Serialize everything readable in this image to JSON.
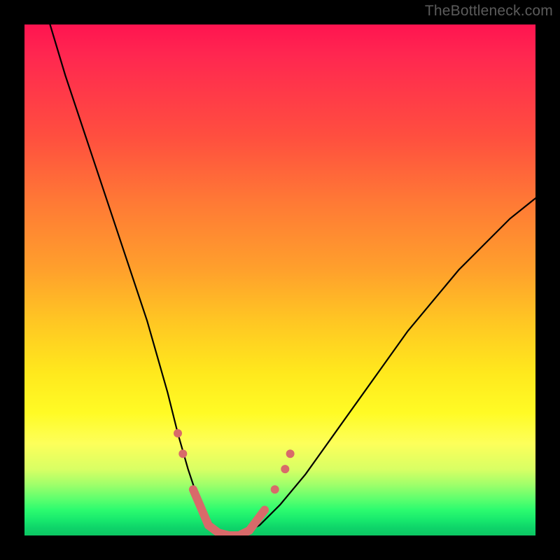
{
  "watermark": "TheBottleneck.com",
  "colors": {
    "curve_stroke": "#000000",
    "marker_fill": "#d86a6a",
    "frame": "#000000"
  },
  "chart_data": {
    "type": "line",
    "title": "",
    "xlabel": "",
    "ylabel": "",
    "xlim": [
      0,
      100
    ],
    "ylim": [
      0,
      100
    ],
    "series": [
      {
        "name": "bottleneck-curve",
        "x": [
          5,
          8,
          12,
          16,
          20,
          24,
          28,
          30,
          32,
          34,
          36,
          38,
          40,
          42,
          46,
          50,
          55,
          60,
          65,
          70,
          75,
          80,
          85,
          90,
          95,
          100
        ],
        "y": [
          100,
          90,
          78,
          66,
          54,
          42,
          28,
          20,
          13,
          7,
          3,
          1,
          0,
          0,
          2,
          6,
          12,
          19,
          26,
          33,
          40,
          46,
          52,
          57,
          62,
          66
        ]
      }
    ],
    "markers": {
      "name": "highlighted-range",
      "comment": "salmon rounded markers near curve minimum",
      "points": [
        {
          "x": 30,
          "y": 20
        },
        {
          "x": 31,
          "y": 16
        },
        {
          "x": 33,
          "y": 9
        },
        {
          "x": 36,
          "y": 2
        },
        {
          "x": 38,
          "y": 0.5
        },
        {
          "x": 40,
          "y": 0
        },
        {
          "x": 42,
          "y": 0
        },
        {
          "x": 44,
          "y": 1
        },
        {
          "x": 47,
          "y": 5
        },
        {
          "x": 49,
          "y": 9
        },
        {
          "x": 51,
          "y": 13
        },
        {
          "x": 52,
          "y": 16
        }
      ]
    },
    "gradient_stops": [
      {
        "pos": 0.0,
        "color": "#ff1450"
      },
      {
        "pos": 0.35,
        "color": "#ff7a35"
      },
      {
        "pos": 0.68,
        "color": "#ffe81d"
      },
      {
        "pos": 0.93,
        "color": "#5aff6e"
      },
      {
        "pos": 1.0,
        "color": "#0cc763"
      }
    ]
  }
}
